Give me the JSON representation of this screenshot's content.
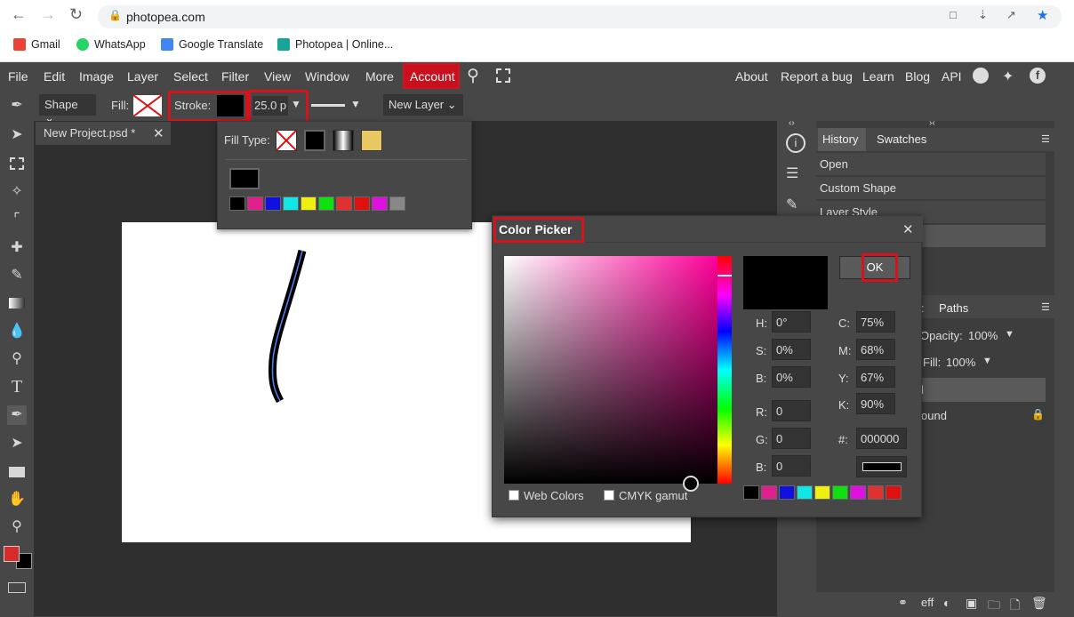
{
  "browser": {
    "url": "photopea.com",
    "bookmarks": [
      "Gmail",
      "WhatsApp",
      "Google Translate",
      "Photopea | Online..."
    ]
  },
  "menu": {
    "items": [
      "File",
      "Edit",
      "Image",
      "Layer",
      "Select",
      "Filter",
      "View",
      "Window",
      "More"
    ],
    "account": "Account",
    "right_links": [
      "About",
      "Report a bug",
      "Learn",
      "Blog",
      "API"
    ]
  },
  "options": {
    "shape_label": "Shape",
    "fill_label": "Fill:",
    "stroke_label": "Stroke:",
    "stroke_width": "25.0 p",
    "new_layer_label": "New Layer"
  },
  "document": {
    "tab_title": "New Project.psd *"
  },
  "fill_popup": {
    "fill_type_label": "Fill Type:"
  },
  "panel": {
    "tabs": [
      "History",
      "Swatches"
    ],
    "history": [
      "Open",
      "Custom Shape",
      "Layer Style"
    ],
    "layers_tabs": [
      ":",
      "Paths"
    ],
    "opacity_label": "Opacity:",
    "opacity_value": "100%",
    "fill_label": "Fill:",
    "fill_value": "100%",
    "layer_names": [
      "l",
      "ound"
    ]
  },
  "color_picker": {
    "title": "Color Picker",
    "ok": "OK",
    "hsb": [
      {
        "label": "H:",
        "value": "0°"
      },
      {
        "label": "S:",
        "value": "0%"
      },
      {
        "label": "B:",
        "value": "0%"
      }
    ],
    "rgb": [
      {
        "label": "R:",
        "value": "0"
      },
      {
        "label": "G:",
        "value": "0"
      },
      {
        "label": "B:",
        "value": "0"
      }
    ],
    "cmyk": [
      {
        "label": "C:",
        "value": "75%"
      },
      {
        "label": "M:",
        "value": "68%"
      },
      {
        "label": "Y:",
        "value": "67%"
      },
      {
        "label": "K:",
        "value": "90%"
      }
    ],
    "hex_label": "#:",
    "hex_value": "000000",
    "web_colors": "Web Colors",
    "cmyk_gamut": "CMYK gamut"
  },
  "colors": {
    "accent_red": "#d3131d",
    "swatches": [
      "#000000",
      "#e0208c",
      "#1010e0",
      "#10e8e8",
      "#f0f010",
      "#10e010",
      "#e03030",
      "#e01010",
      "#e010e0",
      "#888888"
    ]
  }
}
